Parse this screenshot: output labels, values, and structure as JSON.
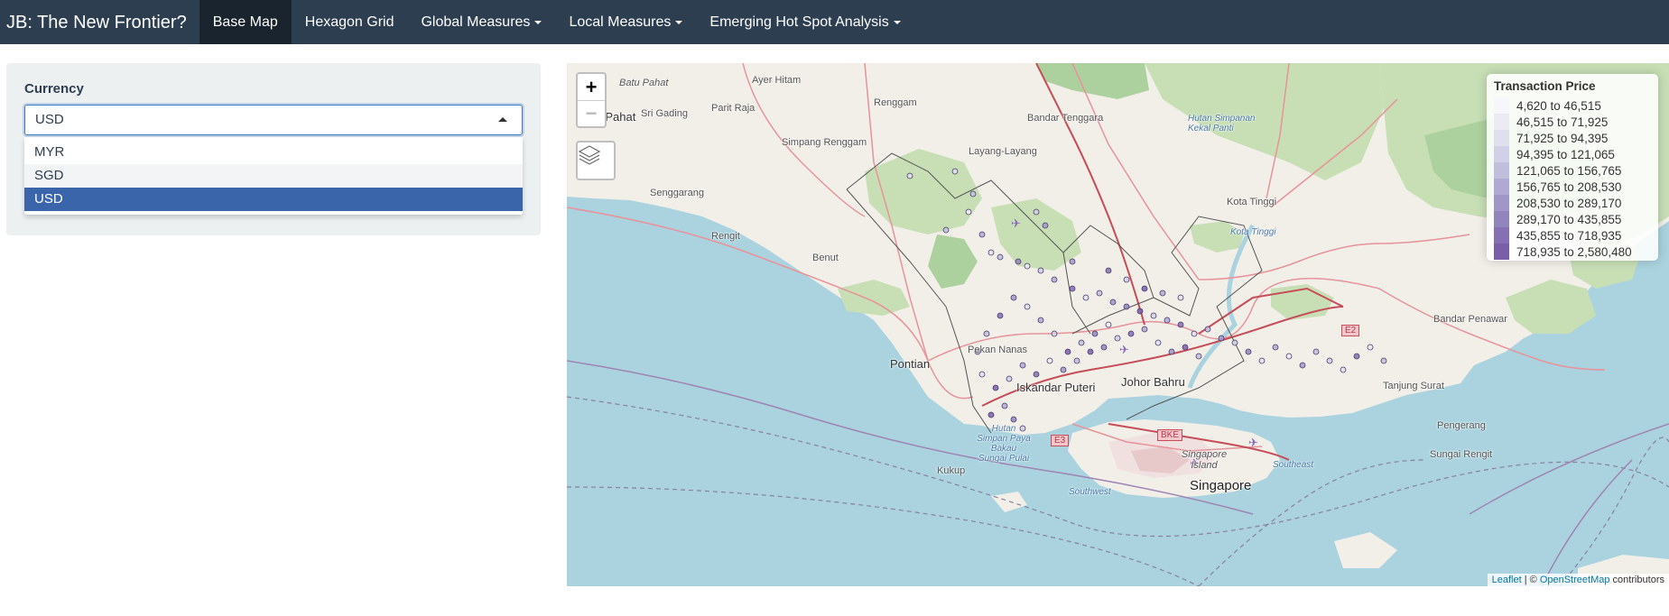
{
  "navbar": {
    "brand": "JB: The New Frontier?",
    "items": [
      {
        "label": "Base Map",
        "active": true,
        "dropdown": false
      },
      {
        "label": "Hexagon Grid",
        "active": false,
        "dropdown": false
      },
      {
        "label": "Global Measures",
        "active": false,
        "dropdown": true
      },
      {
        "label": "Local Measures",
        "active": false,
        "dropdown": true
      },
      {
        "label": "Emerging Hot Spot Analysis",
        "active": false,
        "dropdown": true
      }
    ]
  },
  "sidebar": {
    "currency_label": "Currency",
    "currency_value": "USD",
    "options": [
      "MYR",
      "SGD",
      "USD"
    ],
    "selected_option": "USD"
  },
  "map": {
    "zoom_in": "+",
    "zoom_out": "−",
    "layers_icon": "layers-icon",
    "legend": {
      "title": "Transaction Price",
      "bins": [
        {
          "label": "4,620 to 46,515",
          "color": "#f7f7fb"
        },
        {
          "label": "46,515 to 71,925",
          "color": "#ecebf4"
        },
        {
          "label": "71,925 to 94,395",
          "color": "#e0dfee"
        },
        {
          "label": "94,395 to 121,065",
          "color": "#d1d0e6"
        },
        {
          "label": "121,065 to 156,765",
          "color": "#c1bedd"
        },
        {
          "label": "156,765 to 208,530",
          "color": "#b0aad3"
        },
        {
          "label": "208,530 to 289,170",
          "color": "#a097c8"
        },
        {
          "label": "289,170 to 435,855",
          "color": "#9284bd"
        },
        {
          "label": "435,855 to 718,935",
          "color": "#8470b2"
        },
        {
          "label": "718,935 to 2,580,480",
          "color": "#7a5fa8"
        }
      ]
    },
    "attribution": {
      "leaflet": "Leaflet",
      "separator": " | © ",
      "osm": "OpenStreetMap",
      "suffix": " contributors"
    },
    "places": {
      "batu_pahat_small": "Batu Pahat",
      "batu_pahat": "Batu Pahat",
      "sri_gading": "Sri Gading",
      "parit_raja": "Parit Raja",
      "ayer_hitam": "Ayer Hitam",
      "renggam": "Renggam",
      "bandar_tenggara": "Bandar Tenggara",
      "hutan_simpanan": "Hutan Simpanan Kekal Panti",
      "simpang_renggam": "Simpang Renggam",
      "layang_layang": "Layang-Layang",
      "senggarang": "Senggarang",
      "kota_tinggi": "Kota Tinggi",
      "kota_tinggi_water": "Kota Tinggi",
      "rengit": "Rengit",
      "benut": "Benut",
      "pontian": "Pontian",
      "pekan_nanas": "Pekan Nanas",
      "johor_bahru": "Johor Bahru",
      "iskandar_puteri": "Iskandar Puteri",
      "kukup": "Kukup",
      "singapore": "Singapore",
      "singapore_island": "Singapore Island",
      "southwest": "Southwest",
      "southeast": "Southeast",
      "tanjung_surat": "Tanjung Surat",
      "pengerang": "Pengerang",
      "sungai_rengit": "Sungai Rengit",
      "bandar_penawar": "Bandar Penawar",
      "hutan_simpan": "Hutan Simpan Paya Bakau Sungai Pulai",
      "e2": "E2",
      "e3": "E3",
      "bke": "BKE"
    }
  }
}
